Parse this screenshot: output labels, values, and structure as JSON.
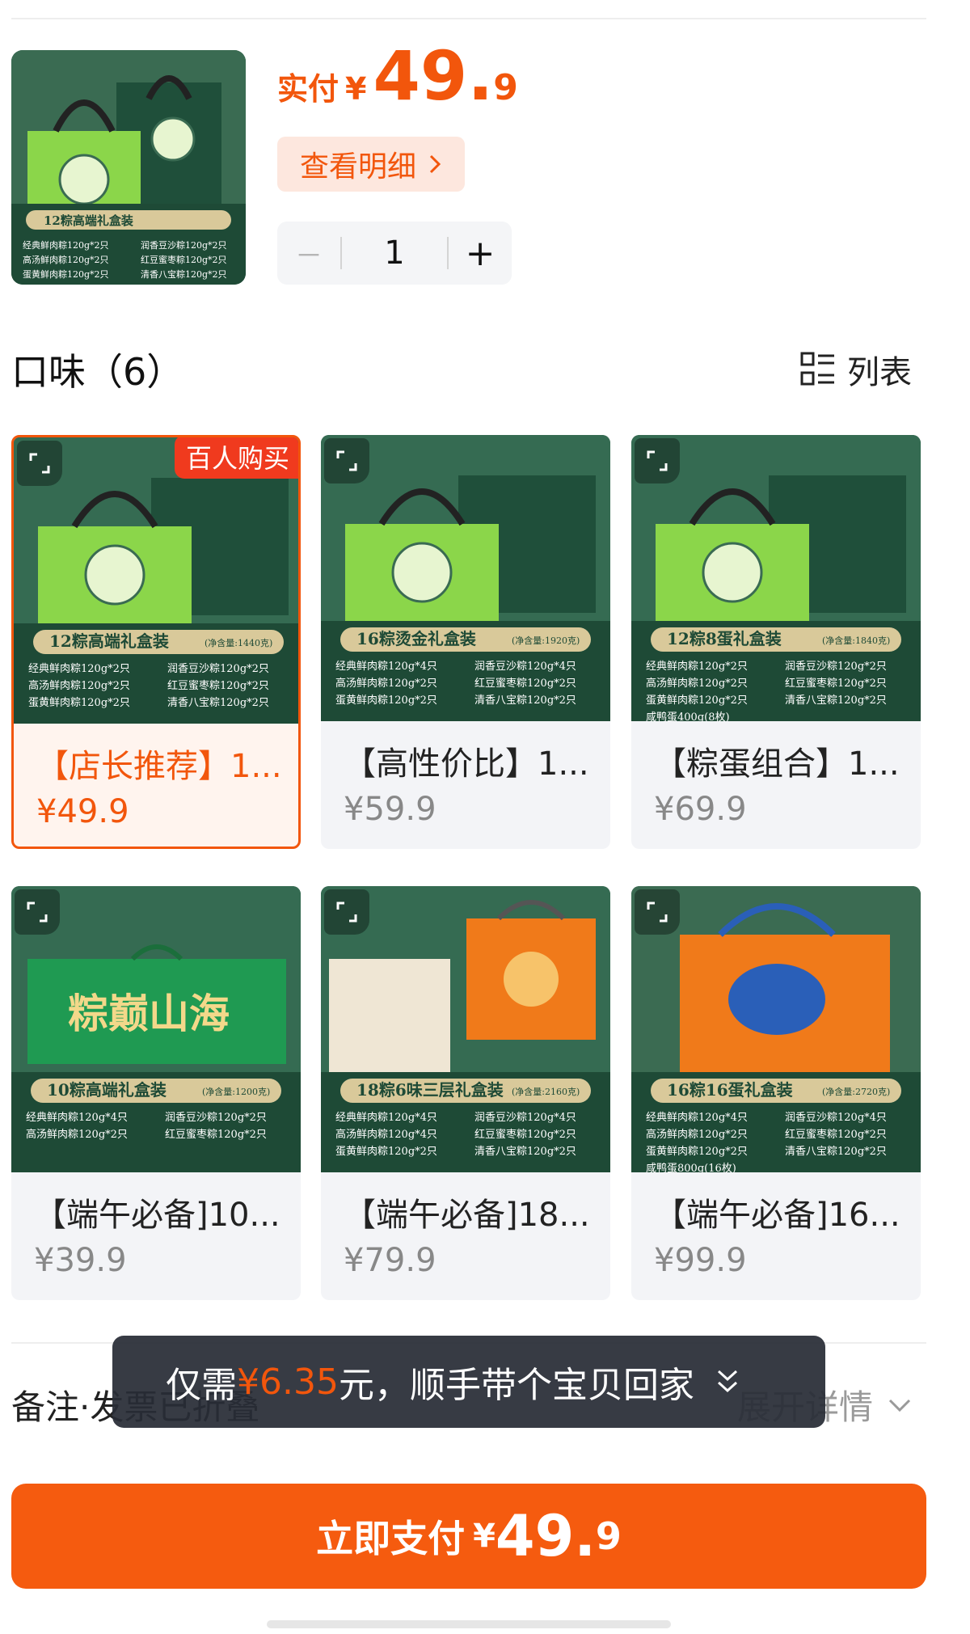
{
  "summary": {
    "pay_label": "实付",
    "currency": "¥",
    "price_int": "49.",
    "price_dec": "9",
    "detail_label": "查看明细",
    "qty_minus": "－",
    "quantity": "1",
    "qty_plus": "+"
  },
  "section": {
    "title": "口味（6）",
    "list_label": "列表"
  },
  "products": [
    {
      "name": "【店长推荐】1...",
      "price": "¥49.9",
      "selected": true,
      "tag": "百人购买",
      "box_title": "12粽高端礼盒装",
      "net": "(净含量:1440克)",
      "lines": [
        "经典鲜肉粽120g*2只",
        "润香豆沙粽120g*2只",
        "高汤鲜肉粽120g*2只",
        "红豆蜜枣粽120g*2只",
        "蛋黄鲜肉粽120g*2只",
        "清香八宝粽120g*2只"
      ]
    },
    {
      "name": "【高性价比】1...",
      "price": "¥59.9",
      "selected": false,
      "box_title": "16粽烫金礼盒装",
      "net": "(净含量:1920克)",
      "lines": [
        "经典鲜肉粽120g*4只",
        "润香豆沙粽120g*4只",
        "高汤鲜肉粽120g*2只",
        "红豆蜜枣粽120g*2只",
        "蛋黄鲜肉粽120g*2只",
        "清香八宝粽120g*2只"
      ]
    },
    {
      "name": "【粽蛋组合】1...",
      "price": "¥69.9",
      "selected": false,
      "box_title": "12粽8蛋礼盒装",
      "net": "(净含量:1840克)",
      "lines": [
        "经典鲜肉粽120g*2只",
        "润香豆沙粽120g*2只",
        "高汤鲜肉粽120g*2只",
        "红豆蜜枣粽120g*2只",
        "蛋黄鲜肉粽120g*2只",
        "清香八宝粽120g*2只",
        "咸鸭蛋400g(8枚)",
        ""
      ]
    },
    {
      "name": "【端午必备]10...",
      "price": "¥39.9",
      "selected": false,
      "box_title": "10粽高端礼盒装",
      "net": "(净含量:1200克)",
      "banner": "粽巅山海",
      "lines": [
        "经典鲜肉粽120g*4只",
        "润香豆沙粽120g*2只",
        "高汤鲜肉粽120g*2只",
        "红豆蜜枣粽120g*2只"
      ]
    },
    {
      "name": "【端午必备]18...",
      "price": "¥79.9",
      "selected": false,
      "box_title": "18粽6味三层礼盒装",
      "net": "(净含量:2160克)",
      "lines": [
        "经典鲜肉粽120g*4只",
        "润香豆沙粽120g*4只",
        "高汤鲜肉粽120g*4只",
        "红豆蜜枣粽120g*2只",
        "蛋黄鲜肉粽120g*2只",
        "清香八宝粽120g*2只"
      ]
    },
    {
      "name": "【端午必备]16...",
      "price": "¥99.9",
      "selected": false,
      "box_title": "16粽16蛋礼盒装",
      "net": "(净含量:2720克)",
      "lines": [
        "经典鲜肉粽120g*4只",
        "润香豆沙粽120g*4只",
        "高汤鲜肉粽120g*2只",
        "红豆蜜枣粽120g*2只",
        "蛋黄鲜肉粽120g*2只",
        "清香八宝粽120g*2只",
        "咸鸭蛋800g(16枚)",
        ""
      ]
    }
  ],
  "remark": {
    "left_label": "备注·发票已折叠",
    "right_label": "展开详情"
  },
  "toast": {
    "prefix": "仅需",
    "amount": "¥6.35",
    "suffix": "元，顺手带个宝贝回家"
  },
  "pay_button": {
    "label": "立即支付",
    "currency": "¥",
    "price_int": "49.",
    "price_dec": "9"
  },
  "colors": {
    "accent": "#f2560c",
    "box_green_dark": "#1f4f3a",
    "box_green_light": "#8bd64a",
    "box_orange": "#f07a1a"
  }
}
